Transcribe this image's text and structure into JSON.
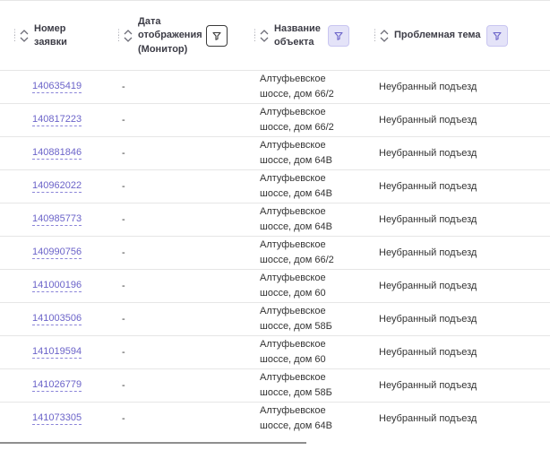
{
  "columns": {
    "number": {
      "title": "Номер заявки"
    },
    "display_date": {
      "title": "Дата отображения (Монитор)"
    },
    "object_name": {
      "title": "Название объекта"
    },
    "problem_topic": {
      "title": "Проблемная тема"
    }
  },
  "colors": {
    "link": "#6b63c9",
    "filter_active_bg": "#e4e3f8",
    "filter_active_icon": "#6b63c9",
    "border": "#e6e6e6"
  },
  "rows": [
    {
      "number": "140635419",
      "date": "-",
      "object": "Алтуфьевское шоссе, дом 66/2",
      "topic": "Неубранный подъезд"
    },
    {
      "number": "140817223",
      "date": "-",
      "object": "Алтуфьевское шоссе, дом 66/2",
      "topic": "Неубранный подъезд"
    },
    {
      "number": "140881846",
      "date": "-",
      "object": "Алтуфьевское шоссе, дом 64В",
      "topic": "Неубранный подъезд"
    },
    {
      "number": "140962022",
      "date": "-",
      "object": "Алтуфьевское шоссе, дом 64В",
      "topic": "Неубранный подъезд"
    },
    {
      "number": "140985773",
      "date": "-",
      "object": "Алтуфьевское шоссе, дом 64В",
      "topic": "Неубранный подъезд"
    },
    {
      "number": "140990756",
      "date": "-",
      "object": "Алтуфьевское шоссе, дом 66/2",
      "topic": "Неубранный подъезд"
    },
    {
      "number": "141000196",
      "date": "-",
      "object": "Алтуфьевское шоссе, дом 60",
      "topic": "Неубранный подъезд"
    },
    {
      "number": "141003506",
      "date": "-",
      "object": "Алтуфьевское шоссе, дом 58Б",
      "topic": "Неубранный подъезд"
    },
    {
      "number": "141019594",
      "date": "-",
      "object": "Алтуфьевское шоссе, дом 60",
      "topic": "Неубранный подъезд"
    },
    {
      "number": "141026779",
      "date": "-",
      "object": "Алтуфьевское шоссе, дом 58Б",
      "topic": "Неубранный подъезд"
    },
    {
      "number": "141073305",
      "date": "-",
      "object": "Алтуфьевское шоссе, дом 64В",
      "topic": "Неубранный подъезд"
    }
  ]
}
